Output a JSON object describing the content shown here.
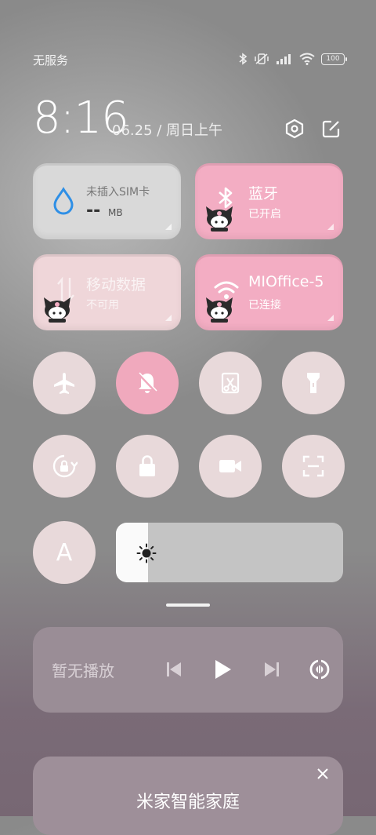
{
  "status": {
    "carrier": "无服务",
    "battery": "100"
  },
  "header": {
    "time": "8:16",
    "date": "06.25 / 周日上午"
  },
  "tiles": {
    "sim": {
      "title": "未插入SIM卡",
      "value": "--",
      "unit": "MB"
    },
    "bluetooth": {
      "title": "蓝牙",
      "status": "已开启"
    },
    "mobile_data": {
      "title": "移动数据",
      "status": "不可用"
    },
    "wifi": {
      "title": "MIOffice-5",
      "status": "已连接"
    }
  },
  "toggles": [
    {
      "icon": "airplane-icon",
      "on": false
    },
    {
      "icon": "bell-off-icon",
      "on": true
    },
    {
      "icon": "screenshot-icon",
      "on": false
    },
    {
      "icon": "flashlight-icon",
      "on": false
    },
    {
      "icon": "rotation-lock-icon",
      "on": false
    },
    {
      "icon": "lock-icon",
      "on": false
    },
    {
      "icon": "screen-record-icon",
      "on": false
    },
    {
      "icon": "scan-icon",
      "on": false
    }
  ],
  "auto_brightness": {
    "label": "A"
  },
  "brightness": {
    "level_percent": 14
  },
  "media": {
    "title": "暂无播放"
  },
  "smart_home": {
    "title": "米家智能家庭"
  },
  "colors": {
    "accent_pink": "#f3adc3",
    "tile_grey": "#d9d9d9",
    "toggle_bg": "#e8d9da"
  }
}
